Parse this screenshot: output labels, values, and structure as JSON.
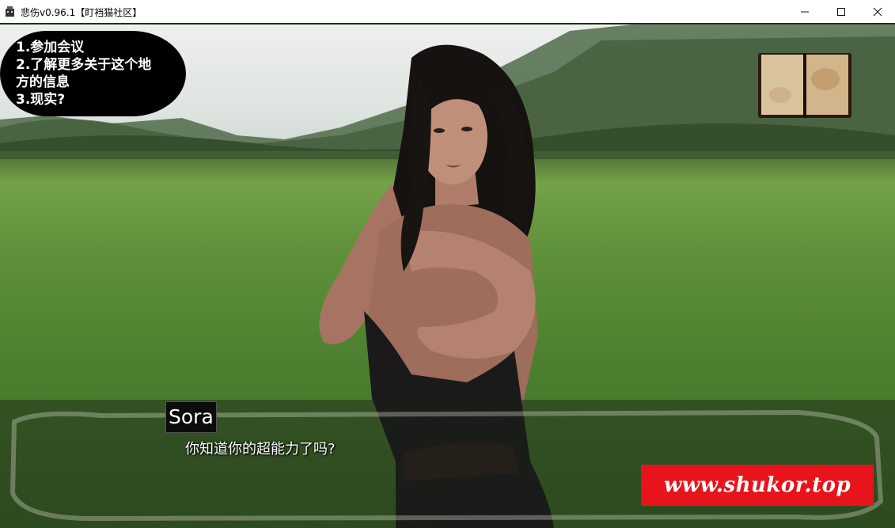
{
  "window": {
    "title": "悲伤v0.96.1【盯裆猫社区】",
    "controls": [
      "minimize",
      "maximize",
      "close"
    ]
  },
  "menu_choices": [
    {
      "label": "1.参加会议"
    },
    {
      "label": "2.了解更多关于这个地"
    },
    {
      "label": "方的信息"
    },
    {
      "label": "3.现实?"
    }
  ],
  "dialogue": {
    "speaker": "Sora",
    "text": "你知道你的超能力了吗?"
  },
  "watermark": {
    "text": "www.shukor.top"
  },
  "colors": {
    "watermark_bg": "#e8141b",
    "choice_bubble_bg": "#000000",
    "text": "#ffffff"
  },
  "icons": {
    "journal": "journal-book-icon",
    "app": "app-icon"
  }
}
